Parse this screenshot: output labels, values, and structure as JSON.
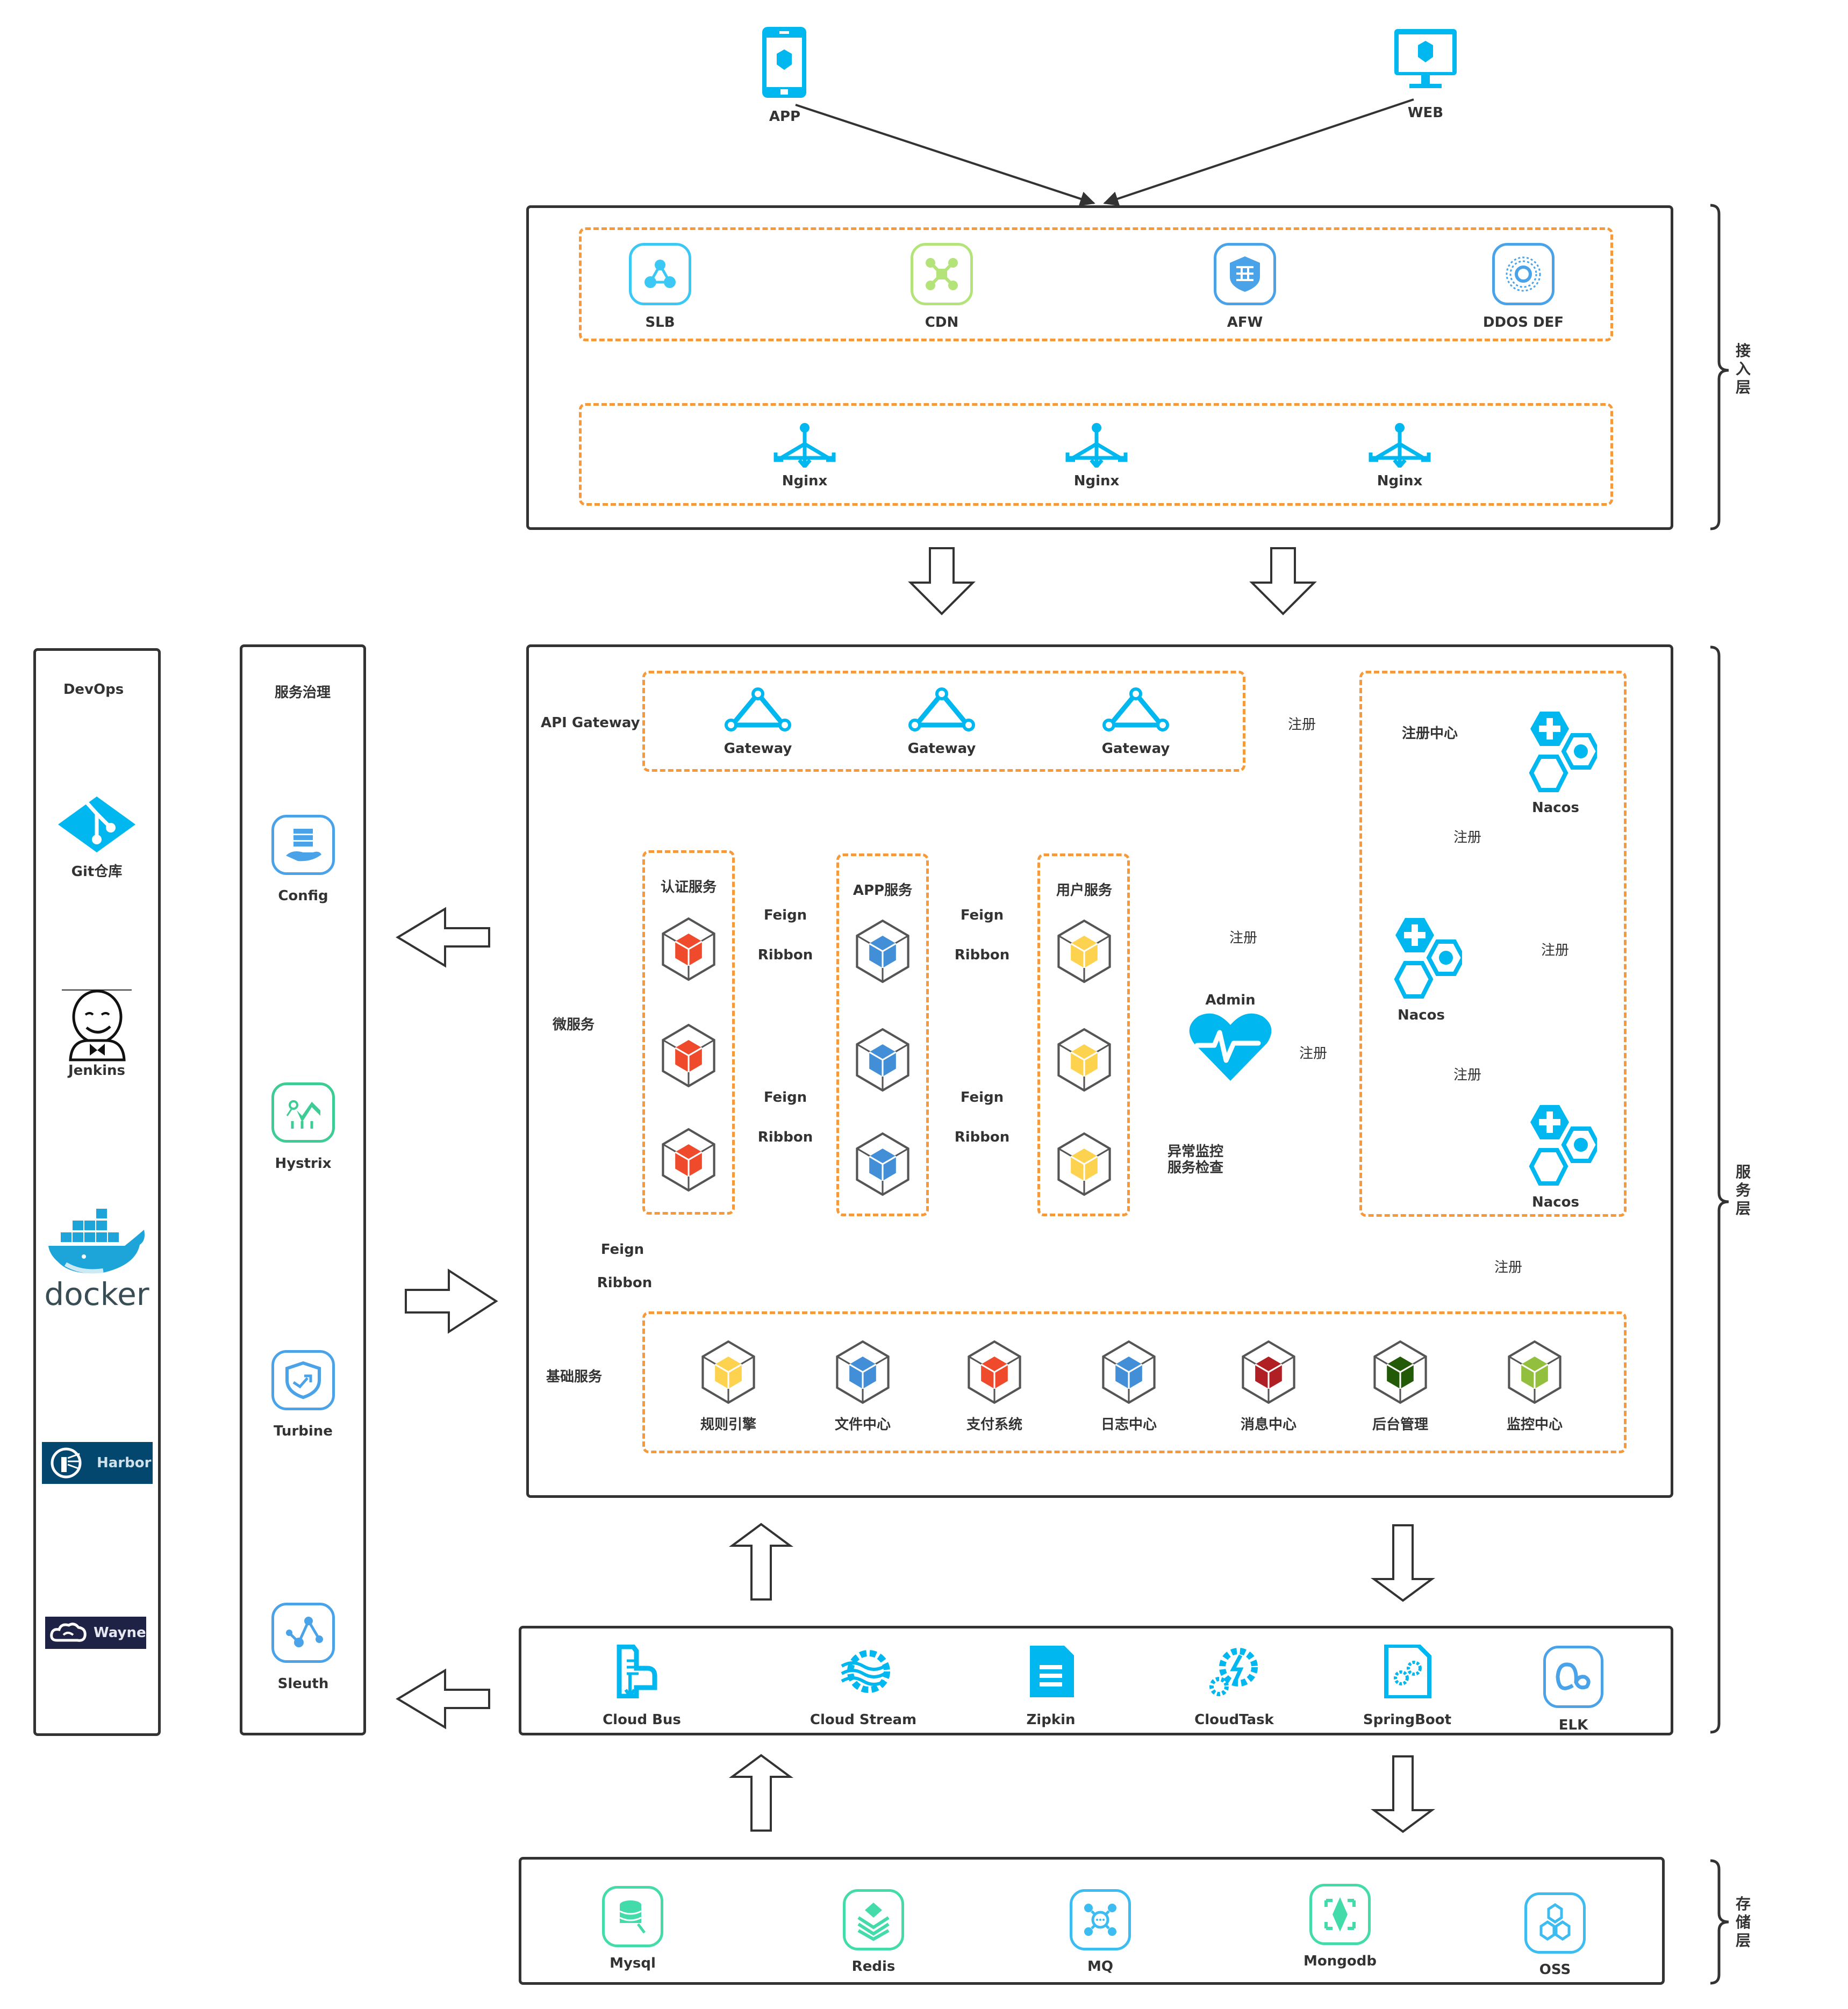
{
  "clients": [
    {
      "label": "APP",
      "icon": "mobile-phone-icon"
    },
    {
      "label": "WEB",
      "icon": "desktop-monitor-icon"
    }
  ],
  "access_layer": {
    "label": "接入层",
    "edge_services": [
      {
        "label": "SLB",
        "icon": "load-balancer-icon",
        "color": "#3cc8f5"
      },
      {
        "label": "CDN",
        "icon": "cdn-icon",
        "color": "#b4e37a"
      },
      {
        "label": "AFW",
        "icon": "firewall-icon",
        "color": "#4aa3e8"
      },
      {
        "label": "DDOS DEF",
        "icon": "ddos-defense-icon",
        "color": "#4aa3e8"
      }
    ],
    "proxies": [
      {
        "label": "Nginx",
        "icon": "nginx-router-icon"
      },
      {
        "label": "Nginx",
        "icon": "nginx-router-icon"
      },
      {
        "label": "Nginx",
        "icon": "nginx-router-icon"
      }
    ]
  },
  "service_layer": {
    "label": "服务层",
    "api_gateway": {
      "label": "API Gateway",
      "gateways": [
        {
          "label": "Gateway"
        },
        {
          "label": "Gateway"
        },
        {
          "label": "Gateway"
        }
      ]
    },
    "microservices": {
      "label": "微服务",
      "groups": [
        {
          "label": "认证服务",
          "color": "#ee4a2b"
        },
        {
          "label": "APP服务",
          "color": "#428fd8"
        },
        {
          "label": "用户服务",
          "color": "#fdd24f"
        }
      ],
      "link_top": "Feign",
      "link_bottom": "Ribbon"
    },
    "base_link": {
      "top": "Feign",
      "bottom": "Ribbon"
    },
    "admin": {
      "label": "Admin",
      "note_line1": "异常监控",
      "note_line2": "服务检查"
    },
    "registry": {
      "label": "注册中心",
      "nodes": [
        {
          "label": "Nacos"
        },
        {
          "label": "Nacos"
        },
        {
          "label": "Nacos"
        }
      ]
    },
    "register_label": "注册",
    "base_services": {
      "label": "基础服务",
      "items": [
        {
          "label": "规则引擎",
          "color": "#fdd24f"
        },
        {
          "label": "文件中心",
          "color": "#428fd8"
        },
        {
          "label": "支付系统",
          "color": "#ee4a2b"
        },
        {
          "label": "日志中心",
          "color": "#428fd8"
        },
        {
          "label": "消息中心",
          "color": "#b01f24"
        },
        {
          "label": "后台管理",
          "color": "#235a07"
        },
        {
          "label": "监控中心",
          "color": "#92bf3d"
        }
      ]
    }
  },
  "middleware": [
    {
      "label": "Cloud Bus",
      "icon": "cloud-bus-icon"
    },
    {
      "label": "Cloud Stream",
      "icon": "cloud-stream-icon"
    },
    {
      "label": "Zipkin",
      "icon": "zipkin-doc-icon"
    },
    {
      "label": "CloudTask",
      "icon": "cloud-task-gear-icon"
    },
    {
      "label": "SpringBoot",
      "icon": "springboot-icon"
    },
    {
      "label": "ELK",
      "icon": "elk-icon"
    }
  ],
  "storage_layer": {
    "label": "存储层",
    "items": [
      {
        "label": "Mysql",
        "icon": "mysql-db-icon",
        "color": "#42dba9"
      },
      {
        "label": "Redis",
        "icon": "redis-stack-icon",
        "color": "#42dba9"
      },
      {
        "label": "MQ",
        "icon": "mq-icon",
        "color": "#3cbcf0"
      },
      {
        "label": "Mongodb",
        "icon": "mongodb-icon",
        "color": "#42dba9"
      },
      {
        "label": "OSS",
        "icon": "oss-icon",
        "color": "#3cbcf0"
      }
    ]
  },
  "devops": {
    "title": "DevOps",
    "steps": [
      {
        "label": "Git仓库",
        "icon": "git-icon"
      },
      {
        "label": "Jenkins",
        "icon": "jenkins-icon"
      },
      {
        "label": "docker",
        "icon": "docker-whale-icon"
      },
      {
        "label": "Harbor",
        "icon": "harbor-lighthouse-icon"
      },
      {
        "label": "Wayne",
        "icon": "wayne-cloud-icon"
      }
    ]
  },
  "governance": {
    "title": "服务治理",
    "items": [
      {
        "label": "Config",
        "icon": "config-server-icon",
        "color": "#4aa3e8"
      },
      {
        "label": "Hystrix",
        "icon": "hystrix-chart-icon",
        "color": "#3dcc93"
      },
      {
        "label": "Turbine",
        "icon": "turbine-shield-icon",
        "color": "#4aa3e8"
      },
      {
        "label": "Sleuth",
        "icon": "sleuth-trace-icon",
        "color": "#4aa3e8"
      }
    ]
  },
  "colors": {
    "accent_blue": "#00b8ef",
    "dashed_orange": "#f6993a",
    "line_dark": "#333333"
  }
}
